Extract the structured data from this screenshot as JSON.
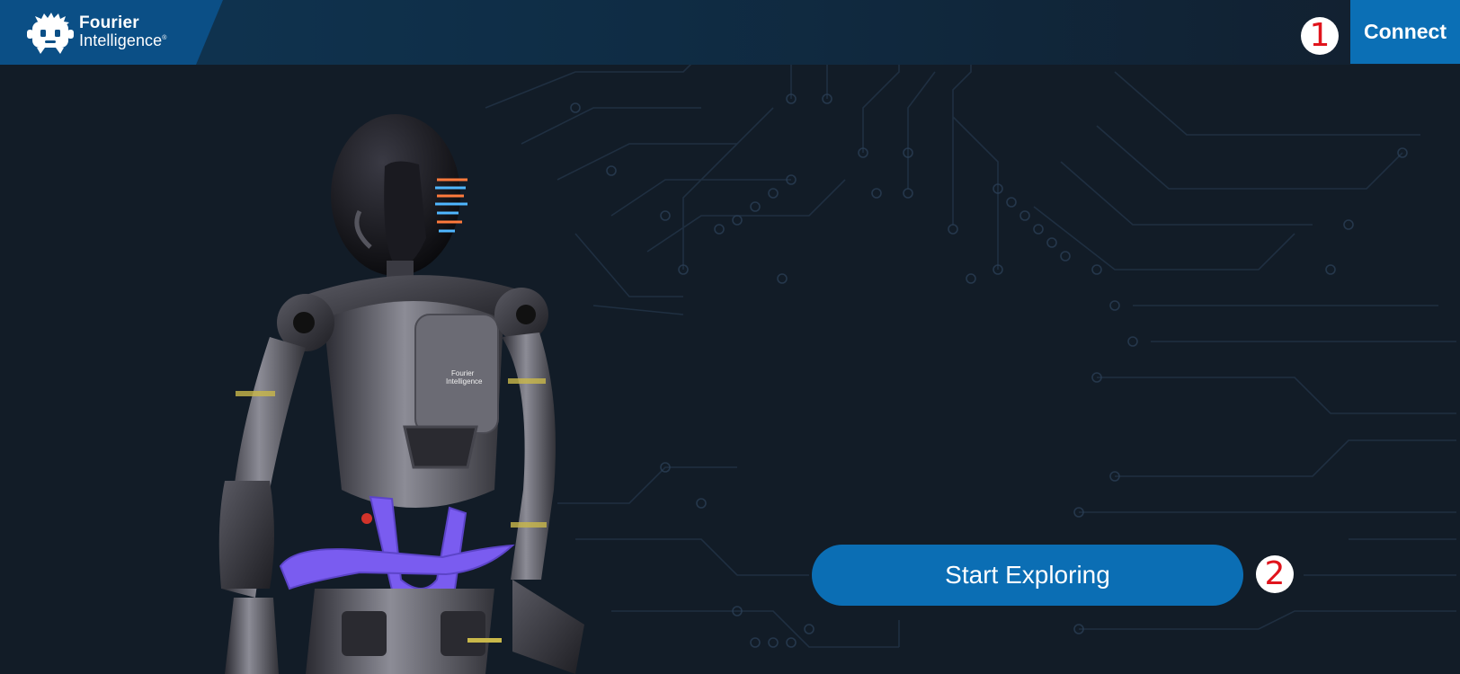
{
  "header": {
    "logo": {
      "line1": "Fourier",
      "line2": "Intelligence",
      "trademark": "®",
      "icon": "fourier-logo-icon"
    },
    "connect_label": "Connect"
  },
  "main": {
    "start_label": "Start Exploring",
    "robot_chest_logo": {
      "line1": "Fourier",
      "line2": "Intelligence"
    }
  },
  "annotations": {
    "marker_1": "1",
    "marker_2": "2"
  },
  "colors": {
    "background": "#121c27",
    "header_gradient_start": "#0f3553",
    "logo_block": "#0b4f86",
    "accent_button": "#0b6eb4",
    "marker_text": "#e0141c",
    "robot_accent": "#7a5cf0"
  }
}
